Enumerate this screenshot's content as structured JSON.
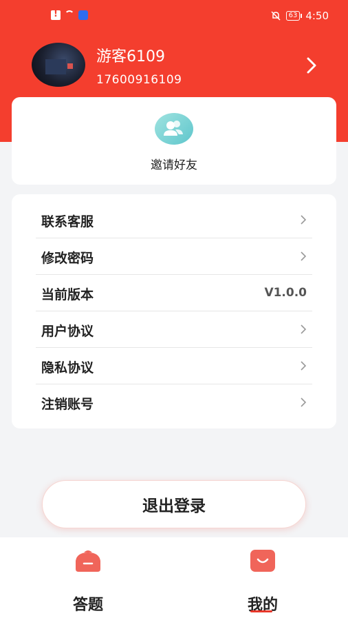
{
  "status_bar": {
    "time": "4:50",
    "battery": "63"
  },
  "profile": {
    "username": "游客6109",
    "phone": "17600916109"
  },
  "invite": {
    "label": "邀请好友"
  },
  "menu": {
    "items": [
      {
        "label": "联系客服",
        "value": null
      },
      {
        "label": "修改密码",
        "value": null
      },
      {
        "label": "当前版本",
        "value": "V1.0.0"
      },
      {
        "label": "用户协议",
        "value": null
      },
      {
        "label": "隐私协议",
        "value": null
      },
      {
        "label": "注销账号",
        "value": null
      }
    ]
  },
  "logout": {
    "label": "退出登录"
  },
  "tabs": [
    {
      "label": "答题",
      "icon": "cap-icon"
    },
    {
      "label": "我的",
      "icon": "smile-icon"
    }
  ],
  "colors": {
    "brand": "#f43e2e",
    "invite_icon": "#72cfd2",
    "indicator": "#e8372a"
  }
}
